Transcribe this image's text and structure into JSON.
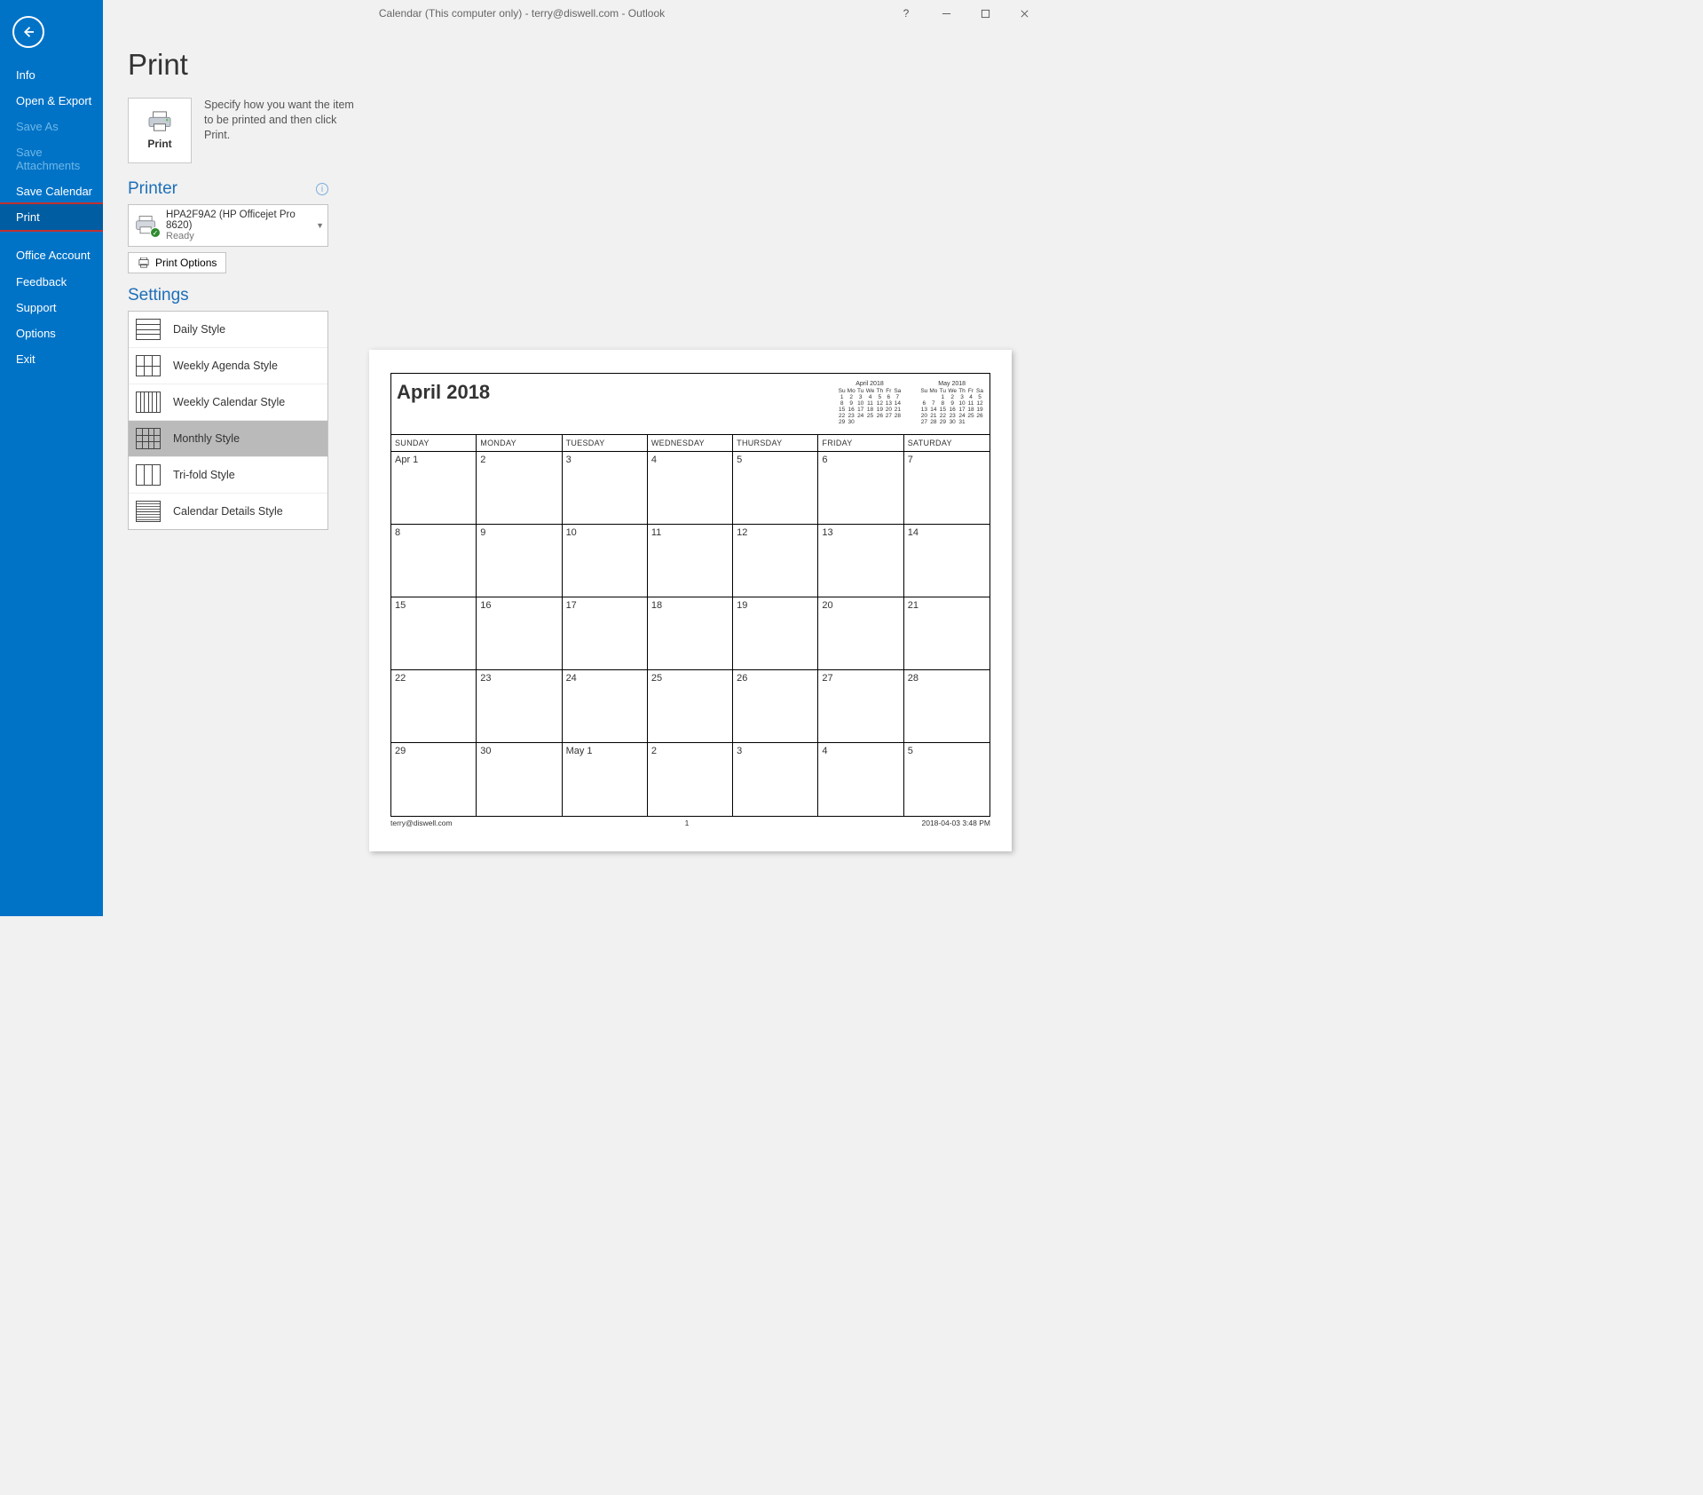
{
  "window": {
    "title": "Calendar (This computer only) - terry@diswell.com  -  Outlook"
  },
  "sidebar": {
    "items": [
      {
        "label": "Info",
        "state": "normal"
      },
      {
        "label": "Open & Export",
        "state": "normal"
      },
      {
        "label": "Save As",
        "state": "disabled"
      },
      {
        "label": "Save Attachments",
        "state": "disabled"
      },
      {
        "label": "Save Calendar",
        "state": "normal"
      },
      {
        "label": "Print",
        "state": "selected"
      },
      {
        "label": "Office Account",
        "state": "normal"
      },
      {
        "label": "Feedback",
        "state": "normal"
      },
      {
        "label": "Support",
        "state": "normal"
      },
      {
        "label": "Options",
        "state": "normal"
      },
      {
        "label": "Exit",
        "state": "normal"
      }
    ]
  },
  "page": {
    "title": "Print",
    "print_tile_label": "Print",
    "description": "Specify how you want the item to be printed and then click Print."
  },
  "printer": {
    "section_label": "Printer",
    "name": "HPA2F9A2 (HP Officejet Pro 8620)",
    "status": "Ready",
    "options_button": "Print Options"
  },
  "settings": {
    "section_label": "Settings",
    "styles": [
      {
        "label": "Daily Style"
      },
      {
        "label": "Weekly Agenda Style"
      },
      {
        "label": "Weekly Calendar Style"
      },
      {
        "label": "Monthly Style",
        "selected": true
      },
      {
        "label": "Tri-fold Style"
      },
      {
        "label": "Calendar Details Style"
      }
    ]
  },
  "preview": {
    "title": "April 2018",
    "dow": [
      "SUNDAY",
      "MONDAY",
      "TUESDAY",
      "WEDNESDAY",
      "THURSDAY",
      "FRIDAY",
      "SATURDAY"
    ],
    "weeks": [
      [
        "Apr 1",
        "2",
        "3",
        "4",
        "5",
        "6",
        "7"
      ],
      [
        "8",
        "9",
        "10",
        "11",
        "12",
        "13",
        "14"
      ],
      [
        "15",
        "16",
        "17",
        "18",
        "19",
        "20",
        "21"
      ],
      [
        "22",
        "23",
        "24",
        "25",
        "26",
        "27",
        "28"
      ],
      [
        "29",
        "30",
        "May 1",
        "2",
        "3",
        "4",
        "5"
      ]
    ],
    "mini": [
      {
        "title": "April 2018",
        "dow": [
          "Su",
          "Mo",
          "Tu",
          "We",
          "Th",
          "Fr",
          "Sa"
        ],
        "rows": [
          [
            "1",
            "2",
            "3",
            "4",
            "5",
            "6",
            "7"
          ],
          [
            "8",
            "9",
            "10",
            "11",
            "12",
            "13",
            "14"
          ],
          [
            "15",
            "16",
            "17",
            "18",
            "19",
            "20",
            "21"
          ],
          [
            "22",
            "23",
            "24",
            "25",
            "26",
            "27",
            "28"
          ],
          [
            "29",
            "30",
            "",
            "",
            "",
            "",
            ""
          ]
        ]
      },
      {
        "title": "May 2018",
        "dow": [
          "Su",
          "Mo",
          "Tu",
          "We",
          "Th",
          "Fr",
          "Sa"
        ],
        "rows": [
          [
            "",
            "",
            "1",
            "2",
            "3",
            "4",
            "5"
          ],
          [
            "6",
            "7",
            "8",
            "9",
            "10",
            "11",
            "12"
          ],
          [
            "13",
            "14",
            "15",
            "16",
            "17",
            "18",
            "19"
          ],
          [
            "20",
            "21",
            "22",
            "23",
            "24",
            "25",
            "26"
          ],
          [
            "27",
            "28",
            "29",
            "30",
            "31",
            "",
            ""
          ]
        ]
      }
    ],
    "footer_email": "terry@diswell.com",
    "footer_page": "1",
    "footer_datetime": "2018-04-03 3:48 PM"
  }
}
